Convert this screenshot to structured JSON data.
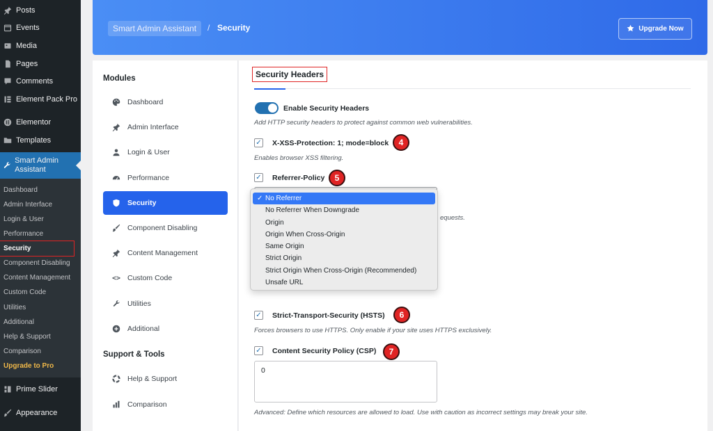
{
  "wp_menu": {
    "items_top": [
      {
        "label": "Posts",
        "icon": "pin-icon"
      },
      {
        "label": "Events",
        "icon": "calendar-icon"
      },
      {
        "label": "Media",
        "icon": "media-icon"
      },
      {
        "label": "Pages",
        "icon": "page-icon"
      },
      {
        "label": "Comments",
        "icon": "comment-icon"
      },
      {
        "label": "Element Pack Pro",
        "icon": "element-pack-icon"
      },
      {
        "label": "Elementor",
        "icon": "elementor-icon"
      },
      {
        "label": "Templates",
        "icon": "folder-icon"
      }
    ],
    "current": {
      "label": "Smart Admin Assistant",
      "icon": "wrench-icon"
    },
    "submenu": [
      "Dashboard",
      "Admin Interface",
      "Login & User",
      "Performance",
      "Security",
      "Component Disabling",
      "Content Management",
      "Custom Code",
      "Utilities",
      "Additional",
      "Help & Support",
      "Comparison"
    ],
    "submenu_upgrade": "Upgrade to Pro",
    "items_bottom": [
      {
        "label": "Prime Slider",
        "icon": "slider-icon"
      },
      {
        "label": "Appearance",
        "icon": "brush-icon"
      }
    ]
  },
  "header": {
    "breadcrumb_root": "Smart Admin Assistant",
    "separator": "/",
    "breadcrumb_current": "Security",
    "upgrade_label": "Upgrade Now"
  },
  "modules_nav": {
    "heading": "Modules",
    "items": [
      {
        "label": "Dashboard",
        "icon": "palette-icon"
      },
      {
        "label": "Admin Interface",
        "icon": "pin-icon"
      },
      {
        "label": "Login & User",
        "icon": "user-icon"
      },
      {
        "label": "Performance",
        "icon": "gauge-icon"
      },
      {
        "label": "Security",
        "icon": "shield-icon"
      },
      {
        "label": "Component Disabling",
        "icon": "brush-icon"
      },
      {
        "label": "Content Management",
        "icon": "pin-icon"
      },
      {
        "label": "Custom Code",
        "icon": "code-icon"
      },
      {
        "label": "Utilities",
        "icon": "wrench-icon"
      },
      {
        "label": "Additional",
        "icon": "plus-circle-icon"
      }
    ],
    "support_heading": "Support & Tools",
    "support_items": [
      {
        "label": "Help & Support",
        "icon": "lifebuoy-icon"
      },
      {
        "label": "Comparison",
        "icon": "bar-chart-icon"
      }
    ]
  },
  "main": {
    "section_title": "Security Headers",
    "enable_label": "Enable Security Headers",
    "enable_desc": "Add HTTP security headers to protect against common web vulnerabilities.",
    "xss_label": "X-XSS-Protection: 1; mode=block",
    "xss_desc": "Enables browser XSS filtering.",
    "xss_badge": "4",
    "referrer_label": "Referrer-Policy",
    "referrer_badge": "5",
    "referrer_desc_tail": "equests.",
    "referrer_options": [
      "No Referrer",
      "No Referrer When Downgrade",
      "Origin",
      "Origin When Cross-Origin",
      "Same Origin",
      "Strict Origin",
      "Strict Origin When Cross-Origin (Recommended)",
      "Unsafe URL"
    ],
    "referrer_selected": "No Referrer",
    "hsts_label": "Strict-Transport-Security (HSTS)",
    "hsts_desc": "Forces browsers to use HTTPS. Only enable if your site uses HTTPS exclusively.",
    "hsts_badge": "6",
    "csp_label": "Content Security Policy (CSP)",
    "csp_badge": "7",
    "csp_value": "0",
    "csp_desc": "Advanced: Define which resources are allowed to load. Use with caution as incorrect settings may break your site."
  },
  "colors": {
    "wp_sidebar": "#1d2327",
    "wp_accent": "#2271b1",
    "nav_active": "#2563eb",
    "badge": "#e02424",
    "upgrade_text": "#f0b849"
  }
}
